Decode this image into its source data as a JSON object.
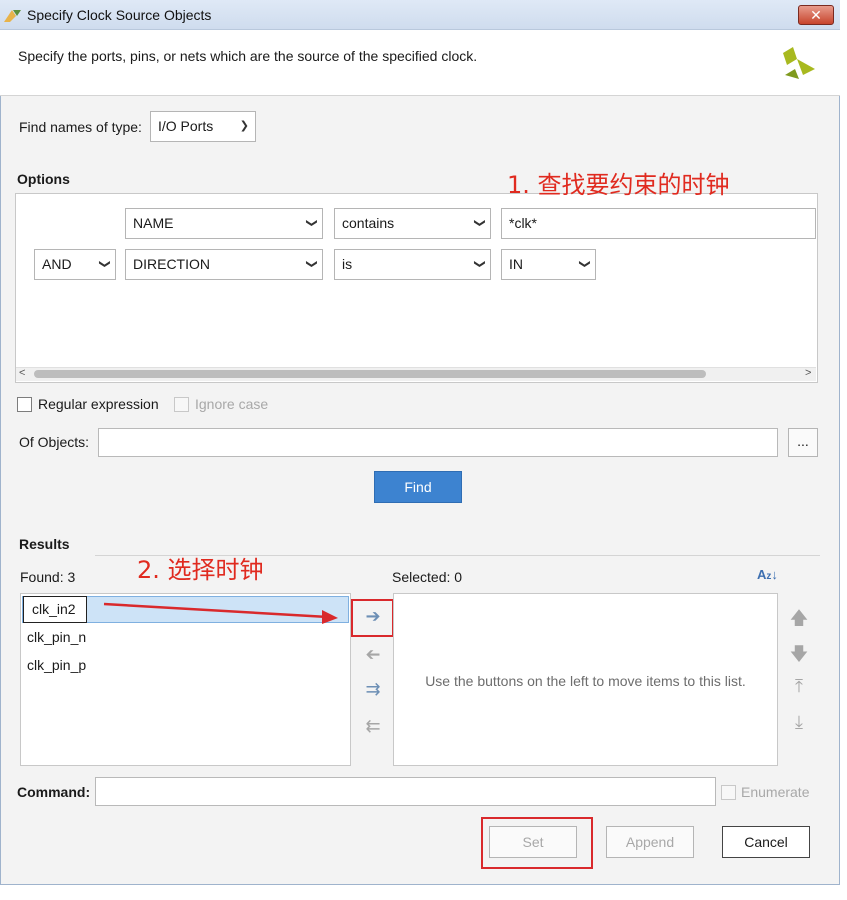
{
  "window": {
    "title": "Specify Clock Source Objects",
    "close_label": "✕"
  },
  "header": {
    "description": "Specify the ports, pins, or nets which are the source of the specified clock.",
    "logo_icon": "xilinx-logo"
  },
  "find_type": {
    "label": "Find names of type:",
    "value": "I/O Ports"
  },
  "options": {
    "heading": "Options",
    "rows": [
      {
        "logic": "",
        "property": "NAME",
        "operator": "contains",
        "value": "*clk*"
      },
      {
        "logic": "AND",
        "property": "DIRECTION",
        "operator": "is",
        "value": "IN"
      }
    ]
  },
  "regex": {
    "label": "Regular expression"
  },
  "ignore_case": {
    "label": "Ignore case"
  },
  "of_objects": {
    "label": "Of Objects:",
    "value": "",
    "browse_label": "..."
  },
  "find_button": "Find",
  "results": {
    "heading": "Results",
    "found_label": "Found: 3",
    "selected_label": "Selected: 0",
    "found_items": [
      "clk_in2",
      "clk_pin_n",
      "clk_pin_p"
    ],
    "empty_hint": "Use the buttons on the left to move items to this list.",
    "sort_icon": "sort-az-icon"
  },
  "command": {
    "label": "Command:",
    "value": ""
  },
  "enumerate": {
    "label": "Enumerate"
  },
  "buttons": {
    "set": "Set",
    "append": "Append",
    "cancel": "Cancel"
  },
  "annotations": {
    "step1": "1. 查找要约束的时钟",
    "step2": "2. 选择时钟"
  },
  "colors": {
    "accent": "#3d83d0",
    "annotation": "#e02a1f",
    "selection": "#cde3f7"
  }
}
